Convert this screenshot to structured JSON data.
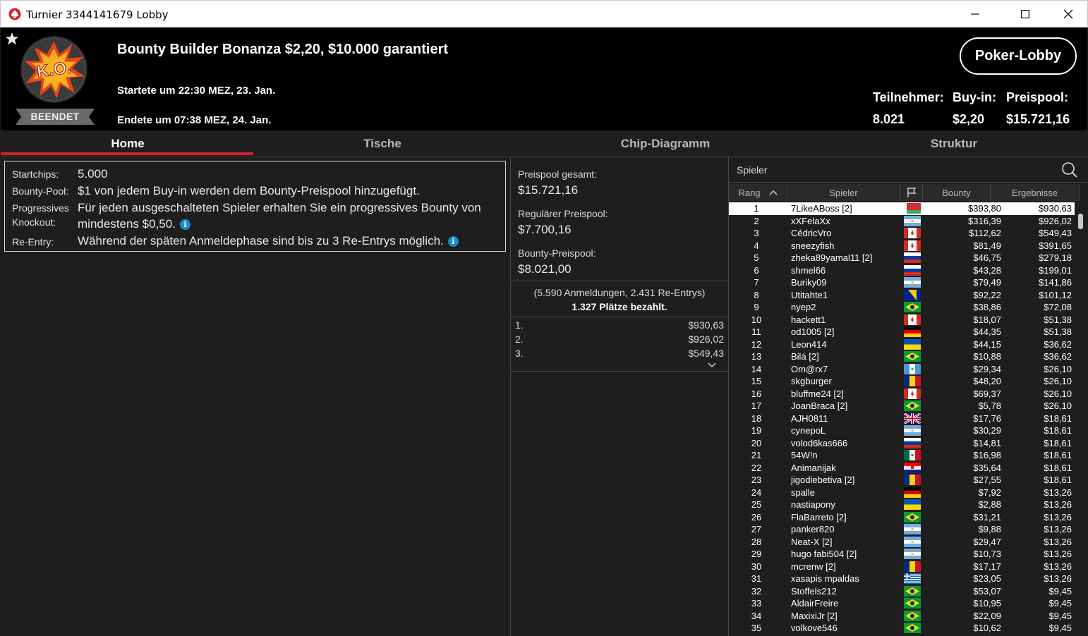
{
  "window": {
    "title": "Turnier 3344141679 Lobby",
    "minimize": "—",
    "maximize": "☐",
    "close": "✕"
  },
  "header": {
    "badge_text": "K.O.",
    "status": "BEENDET",
    "tournament_name": "Bounty Builder Bonanza $2,20, $10.000 garantiert",
    "started": "Startete um 22:30 MEZ, 23. Jan.",
    "ended": "Endete um 07:38 MEZ, 24. Jan.",
    "lobby_button": "Poker-Lobby",
    "stats": {
      "participants_label": "Teilnehmer:",
      "participants_value": "8.021",
      "buyin_label": "Buy-in:",
      "buyin_value": "$2,20",
      "prizepool_label": "Preispool:",
      "prizepool_value": "$15.721,16"
    }
  },
  "tabs": [
    "Home",
    "Tische",
    "Chip-Diagramm",
    "Struktur"
  ],
  "info": {
    "startchips_label": "Startchips:",
    "startchips_value": "5.000",
    "bountypool_label": "Bounty-Pool:",
    "bountypool_value": "$1 von jedem Buy-in werden dem Bounty-Preispool hinzugefügt.",
    "pko_label_1": "Progressives",
    "pko_label_2": "Knockout:",
    "pko_value_1": "Für jeden ausgeschalteten Spieler erhalten Sie ein progressives Bounty von",
    "pko_value_2": "mindestens $0,50.",
    "reentry_label": "Re-Entry:",
    "reentry_value": "Während der späten Anmeldephase sind bis zu 3 Re-Entrys möglich.",
    "info_icon": "i"
  },
  "prizepool": {
    "total_label": "Preispool gesamt:",
    "total_value": "$15.721,16",
    "regular_label": "Regulärer Preispool:",
    "regular_value": "$7.700,16",
    "bounty_label": "Bounty-Preispool:",
    "bounty_value": "$8.021,00",
    "registrations": "(5.590 Anmeldungen, 2.431 Re-Entrys)",
    "paid_places": "1.327 Plätze bezahlt.",
    "payouts": [
      {
        "pos": "1.",
        "amount": "$930,63"
      },
      {
        "pos": "2.",
        "amount": "$926,02"
      },
      {
        "pos": "3.",
        "amount": "$549,43"
      }
    ]
  },
  "players": {
    "search_placeholder": "Spieler",
    "columns": {
      "rank": "Rang",
      "player": "Spieler",
      "bounty": "Bounty",
      "results": "Ergebnisse"
    },
    "rows": [
      {
        "rank": "1",
        "name": "7LikeABoss [2]",
        "flag": "by",
        "bounty": "$393,80",
        "result": "$930,63"
      },
      {
        "rank": "2",
        "name": "xXFelaXx",
        "flag": "ar",
        "bounty": "$316,39",
        "result": "$926,02"
      },
      {
        "rank": "3",
        "name": "CédricVro",
        "flag": "ca",
        "bounty": "$112,62",
        "result": "$549,43"
      },
      {
        "rank": "4",
        "name": "sneezyfish",
        "flag": "ca",
        "bounty": "$81,49",
        "result": "$391,65"
      },
      {
        "rank": "5",
        "name": "zheka89yamal11 [2]",
        "flag": "ru",
        "bounty": "$46,75",
        "result": "$279,18"
      },
      {
        "rank": "6",
        "name": "shmel66",
        "flag": "ru",
        "bounty": "$43,28",
        "result": "$199,01"
      },
      {
        "rank": "7",
        "name": "Buriky09",
        "flag": "ar",
        "bounty": "$79,49",
        "result": "$141,86"
      },
      {
        "rank": "8",
        "name": "Utitahte1",
        "flag": "ba",
        "bounty": "$92,22",
        "result": "$101,12"
      },
      {
        "rank": "9",
        "name": "nyep2",
        "flag": "br",
        "bounty": "$38,86",
        "result": "$72,08"
      },
      {
        "rank": "10",
        "name": "hackett1",
        "flag": "ca",
        "bounty": "$18,07",
        "result": "$51,38"
      },
      {
        "rank": "11",
        "name": "od1005 [2]",
        "flag": "de",
        "bounty": "$44,35",
        "result": "$51,38"
      },
      {
        "rank": "12",
        "name": "Leon414",
        "flag": "ua",
        "bounty": "$44,15",
        "result": "$36,62"
      },
      {
        "rank": "13",
        "name": "Bilá [2]",
        "flag": "br",
        "bounty": "$10,88",
        "result": "$36,62"
      },
      {
        "rank": "14",
        "name": "Om@rx7",
        "flag": "gt",
        "bounty": "$29,34",
        "result": "$26,10"
      },
      {
        "rank": "15",
        "name": "skgburger",
        "flag": "ro",
        "bounty": "$48,20",
        "result": "$26,10"
      },
      {
        "rank": "16",
        "name": "bluffme24 [2]",
        "flag": "ca",
        "bounty": "$69,37",
        "result": "$26,10"
      },
      {
        "rank": "17",
        "name": "JoanBraca [2]",
        "flag": "br",
        "bounty": "$5,78",
        "result": "$26,10"
      },
      {
        "rank": "18",
        "name": "AJH0811",
        "flag": "gb",
        "bounty": "$17,76",
        "result": "$18,61"
      },
      {
        "rank": "19",
        "name": "cynepoL",
        "flag": "ar",
        "bounty": "$30,29",
        "result": "$18,61"
      },
      {
        "rank": "20",
        "name": "volod6kas666",
        "flag": "ru",
        "bounty": "$14,81",
        "result": "$18,61"
      },
      {
        "rank": "21",
        "name": "54W!n",
        "flag": "mx",
        "bounty": "$16,98",
        "result": "$18,61"
      },
      {
        "rank": "22",
        "name": "Animanijak",
        "flag": "hr",
        "bounty": "$35,64",
        "result": "$18,61"
      },
      {
        "rank": "23",
        "name": "jigodiebetiva [2]",
        "flag": "ro",
        "bounty": "$27,55",
        "result": "$18,61"
      },
      {
        "rank": "24",
        "name": "spalle",
        "flag": "de",
        "bounty": "$7,92",
        "result": "$13,26"
      },
      {
        "rank": "25",
        "name": "nastiapony",
        "flag": "ua",
        "bounty": "$2,88",
        "result": "$13,26"
      },
      {
        "rank": "26",
        "name": "FlaBarreto [2]",
        "flag": "br",
        "bounty": "$31,21",
        "result": "$13,26"
      },
      {
        "rank": "27",
        "name": "panker820",
        "flag": "ar",
        "bounty": "$9,88",
        "result": "$13,26"
      },
      {
        "rank": "28",
        "name": "Neat-X [2]",
        "flag": "ar",
        "bounty": "$29,47",
        "result": "$13,26"
      },
      {
        "rank": "29",
        "name": "hugo fabi504 [2]",
        "flag": "ar",
        "bounty": "$10,73",
        "result": "$13,26"
      },
      {
        "rank": "30",
        "name": "mcrenw [2]",
        "flag": "ro",
        "bounty": "$17,17",
        "result": "$13,26"
      },
      {
        "rank": "31",
        "name": "xasapis mpaldas",
        "flag": "gr",
        "bounty": "$23,05",
        "result": "$13,26"
      },
      {
        "rank": "32",
        "name": "Stoffels212",
        "flag": "br",
        "bounty": "$53,07",
        "result": "$9,45"
      },
      {
        "rank": "33",
        "name": "AldairFreire",
        "flag": "br",
        "bounty": "$10,95",
        "result": "$9,45"
      },
      {
        "rank": "34",
        "name": "MaxixiJr [2]",
        "flag": "br",
        "bounty": "$22,09",
        "result": "$9,45"
      },
      {
        "rank": "35",
        "name": "volkove546",
        "flag": "br",
        "bounty": "$10,62",
        "result": "$9,45"
      }
    ]
  },
  "colors": {
    "accent": "#d4202d",
    "header_bg": "#000000",
    "body_bg": "#1e1e1e",
    "info_icon": "#1d8ccf"
  },
  "icons": {
    "app": "pokerstars-spade-icon",
    "favorite": "star-icon",
    "search": "search-icon",
    "sort": "sort-ascending-icon",
    "flag_col": "flag-icon",
    "expand": "chevron-down-icon"
  }
}
